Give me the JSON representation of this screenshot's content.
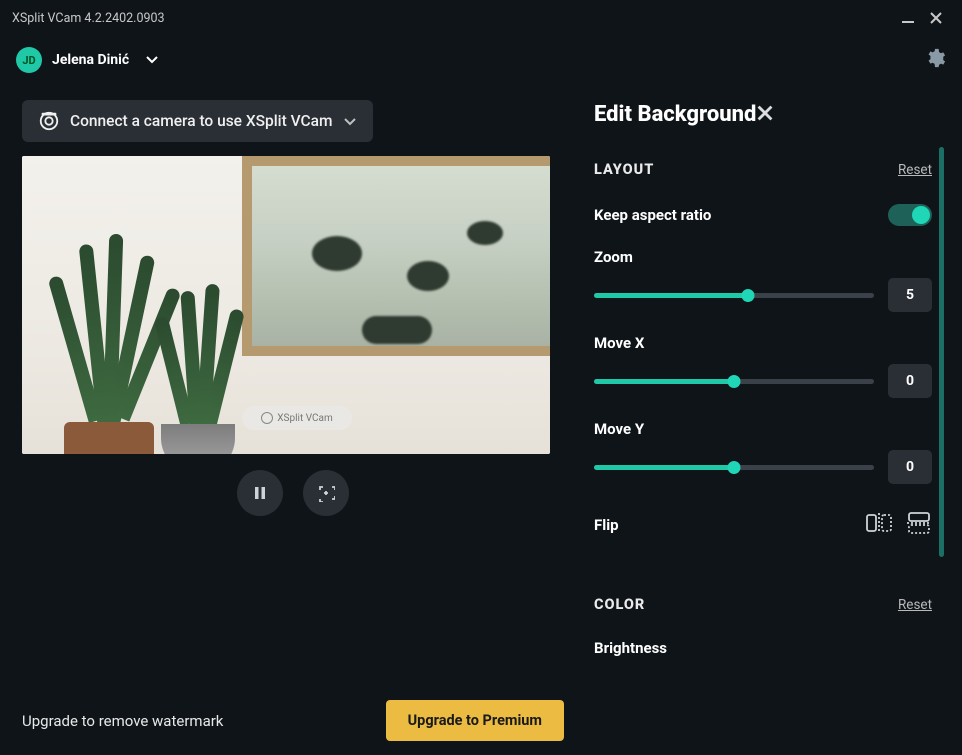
{
  "titlebar": {
    "title": "XSplit VCam 4.2.2402.0903"
  },
  "user": {
    "initials": "JD",
    "name": "Jelena Dinić"
  },
  "camera": {
    "connect_label": "Connect a camera to use XSplit VCam"
  },
  "watermark": {
    "text": "XSplit VCam"
  },
  "upgrade": {
    "text": "Upgrade to remove watermark",
    "button": "Upgrade to Premium"
  },
  "panel": {
    "title": "Edit Background",
    "layout": {
      "label": "LAYOUT",
      "reset": "Reset",
      "keep_aspect": {
        "label": "Keep aspect ratio",
        "on": true
      },
      "zoom": {
        "label": "Zoom",
        "value": "5",
        "fill_pct": 55
      },
      "movex": {
        "label": "Move X",
        "value": "0",
        "fill_pct": 50
      },
      "movey": {
        "label": "Move Y",
        "value": "0",
        "fill_pct": 50
      },
      "flip": {
        "label": "Flip"
      }
    },
    "color": {
      "label": "COLOR",
      "reset": "Reset",
      "brightness": {
        "label": "Brightness"
      }
    }
  }
}
